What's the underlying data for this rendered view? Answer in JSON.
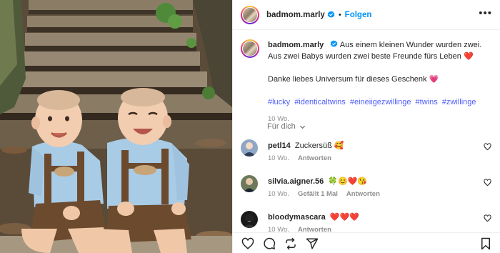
{
  "post": {
    "username": "badmom.marly",
    "separator": "•",
    "follow_label": "Folgen",
    "more_label": "•••"
  },
  "caption": {
    "username": "badmom.marly",
    "line1": "Aus einem kleinen Wunder wurden zwei. Aus zwei Babys wurden zwei beste Freunde fürs Leben",
    "emoji1": "❤️",
    "line2": "Danke liebes Universum für dieses Geschenk",
    "emoji2": "💗",
    "hashtags": [
      "#lucky",
      "#identicaltwins",
      "#eineiigezwillinge",
      "#twins",
      "#zwillinge"
    ],
    "age": "10 Wo."
  },
  "translate": {
    "label": "Für dich"
  },
  "comments": [
    {
      "username": "petl14",
      "text": "Zuckersüß",
      "emoji": "🥰",
      "age": "10 Wo.",
      "likes": "",
      "reply_label": "Antworten"
    },
    {
      "username": "silvia.aigner.56",
      "text": "",
      "emoji": "🍀😊❤️😘",
      "age": "10 Wo.",
      "likes": "Gefällt 1 Mal",
      "reply_label": "Antworten"
    },
    {
      "username": "bloodymascara",
      "text": "",
      "emoji": "❤️❤️❤️",
      "age": "10 Wo.",
      "likes": "",
      "reply_label": "Antworten"
    }
  ],
  "icons": [
    "verified-icon",
    "more-icon",
    "heart-icon",
    "comment-icon",
    "repost-icon",
    "share-icon",
    "bookmark-icon",
    "chevron-down-icon"
  ],
  "colors": {
    "link_blue": "#0095f6",
    "hashtag": "#4e5df5",
    "verified": "#0095f6",
    "text": "#262626",
    "muted": "#8e8e8e"
  }
}
